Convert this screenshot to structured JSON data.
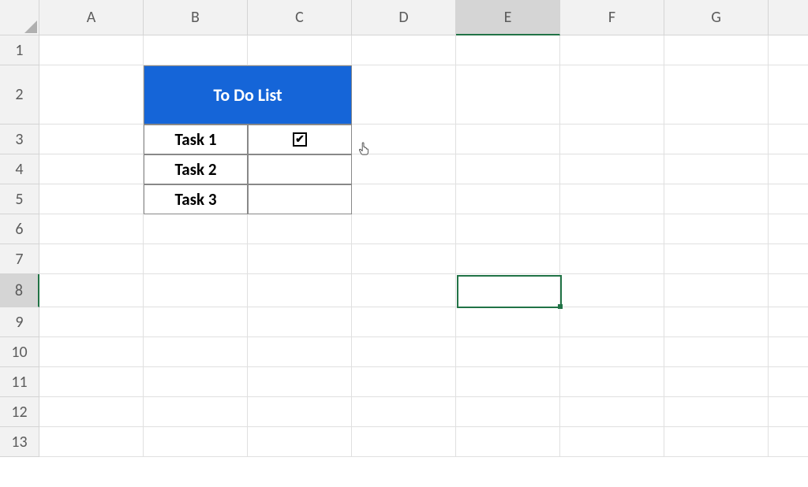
{
  "columns": [
    "A",
    "B",
    "C",
    "D",
    "E",
    "F",
    "G"
  ],
  "rows": [
    "1",
    "2",
    "3",
    "4",
    "5",
    "6",
    "7",
    "8",
    "9",
    "10",
    "11",
    "12",
    "13"
  ],
  "selected_column": "E",
  "selected_row": "8",
  "title": "To Do List",
  "tasks": [
    {
      "label": "Task 1",
      "checked": true
    },
    {
      "label": "Task 2",
      "checked": false
    },
    {
      "label": "Task 3",
      "checked": false
    }
  ],
  "active_cell": "E8",
  "colors": {
    "title_bg": "#1565d8",
    "selection": "#217346"
  }
}
